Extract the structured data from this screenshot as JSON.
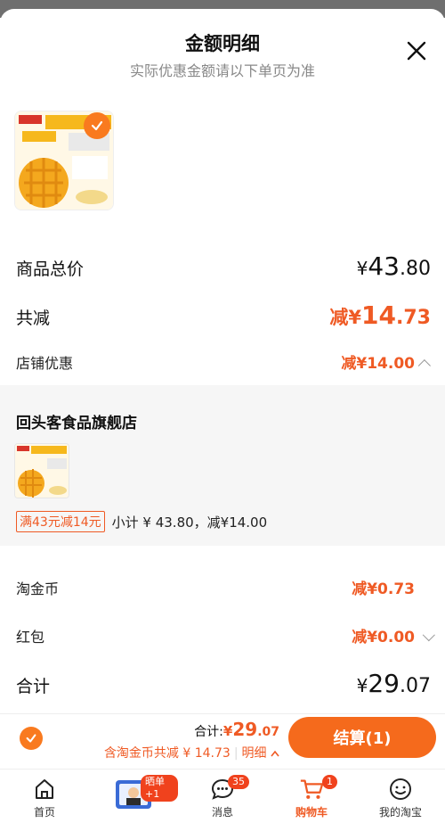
{
  "sheet": {
    "title": "金额明细",
    "subtitle": "实际优惠金额请以下单页为准"
  },
  "summary": {
    "total_label": "商品总价",
    "total_currency": "¥",
    "total_int": "43",
    "total_dec": ".80",
    "reduce_label": "共减",
    "reduce_prefix": "减¥",
    "reduce_int": "14",
    "reduce_dec": ".73",
    "store_discount_label": "店铺优惠",
    "store_discount_value": "减¥14.00"
  },
  "store": {
    "name": "回头客食品旗舰店",
    "promo_tag": "满43元减14元",
    "promo_text": "小计 ¥ 43.80，减¥14.00"
  },
  "extras": {
    "coin_label": "淘金币",
    "coin_value": "减¥0.73",
    "redpacket_label": "红包",
    "redpacket_value": "减¥0.00",
    "grand_label": "合计",
    "grand_currency": "¥",
    "grand_int": "29",
    "grand_dec": ".07"
  },
  "checkout": {
    "sum_label": "合计:",
    "sum_currency": "¥",
    "sum_int": "29",
    "sum_dec": ".07",
    "sub_text": "含淘金币共减 ¥ 14.73",
    "detail_link": "明细",
    "pay_label": "结算(1)"
  },
  "tabs": [
    {
      "label": "首页",
      "icon": "home-icon"
    },
    {
      "label": "晒单+1",
      "icon": "share-order-icon"
    },
    {
      "label": "消息",
      "icon": "message-icon",
      "badge": "35"
    },
    {
      "label": "购物车",
      "icon": "cart-icon",
      "badge": "1",
      "active": true
    },
    {
      "label": "我的淘宝",
      "icon": "profile-icon"
    }
  ],
  "colors": {
    "accent": "#ef5a24",
    "button": "#f56a1c",
    "badge": "#f0421d"
  }
}
